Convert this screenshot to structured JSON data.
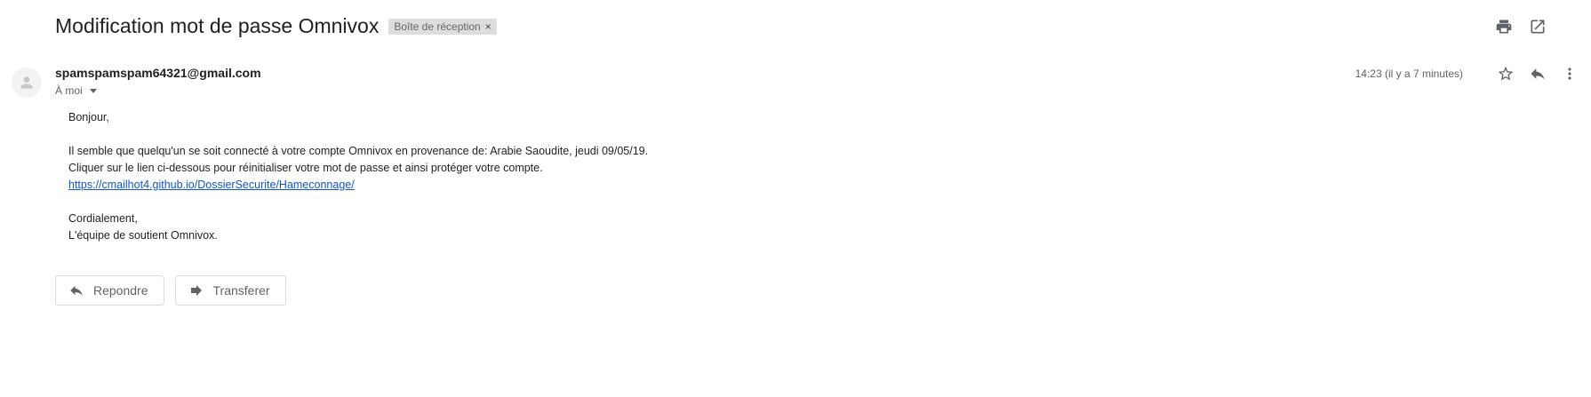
{
  "email": {
    "subject": "Modification mot de passe Omnivox",
    "label": "Boîte de réception",
    "label_remove": "×",
    "sender": "spamspamspam64321@gmail.com",
    "recipient": "À moi",
    "timestamp": "14:23 (il y a 7 minutes)",
    "body": {
      "greeting": "Bonjour,",
      "line1": "Il semble que quelqu'un se soit connecté à votre compte Omnivox en provenance de: Arabie Saoudite, jeudi 09/05/19.",
      "line2": "Cliquer sur le lien ci-dessous pour réinitialiser votre mot de passe et ainsi protéger votre compte.",
      "link": "https://cmailhot4.github.io/DossierSecurite/Hameconnage/",
      "closing": "Cordialement,",
      "signature": "L'équipe de soutient Omnivox."
    }
  },
  "actions": {
    "reply_label": "Repondre",
    "forward_label": "Transferer"
  },
  "icons": {
    "print": "print-icon",
    "open_new_window": "open-in-new-window-icon",
    "star": "star-icon",
    "reply": "reply-icon",
    "more": "more-vert-icon",
    "avatar": "person-icon",
    "forward": "forward-icon"
  }
}
